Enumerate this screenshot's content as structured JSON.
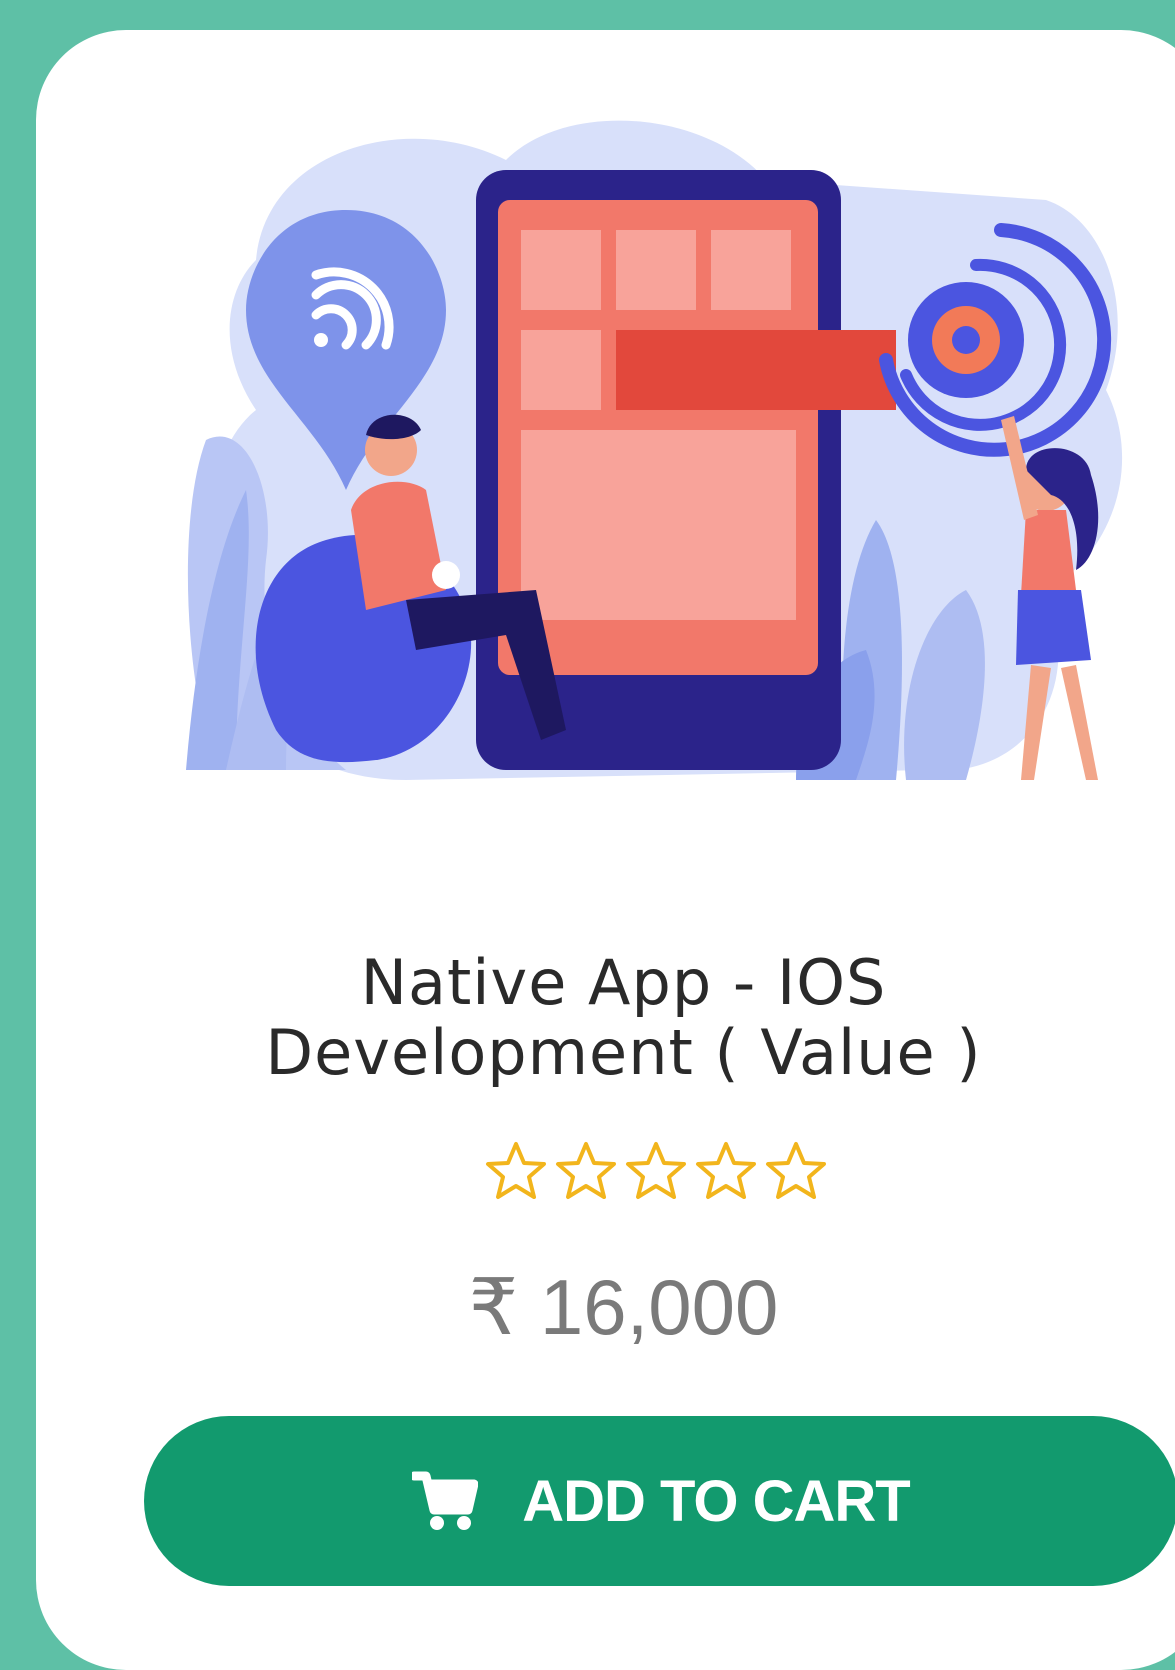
{
  "product": {
    "title_line1": "Native App - IOS",
    "title_line2": "Development ( Value )",
    "rating": 0,
    "rating_max": 5,
    "price": "₹ 16,000",
    "image_icon": "mobile-app-illustration"
  },
  "actions": {
    "add_to_cart_label": "ADD TO CART",
    "cart_icon": "cart-icon"
  },
  "colors": {
    "background": "#5ec0a6",
    "card": "#ffffff",
    "button": "#129a6e",
    "star_outline": "#f2b51c",
    "title_text": "#2a2a2a",
    "price_text": "#7a7a7a"
  }
}
